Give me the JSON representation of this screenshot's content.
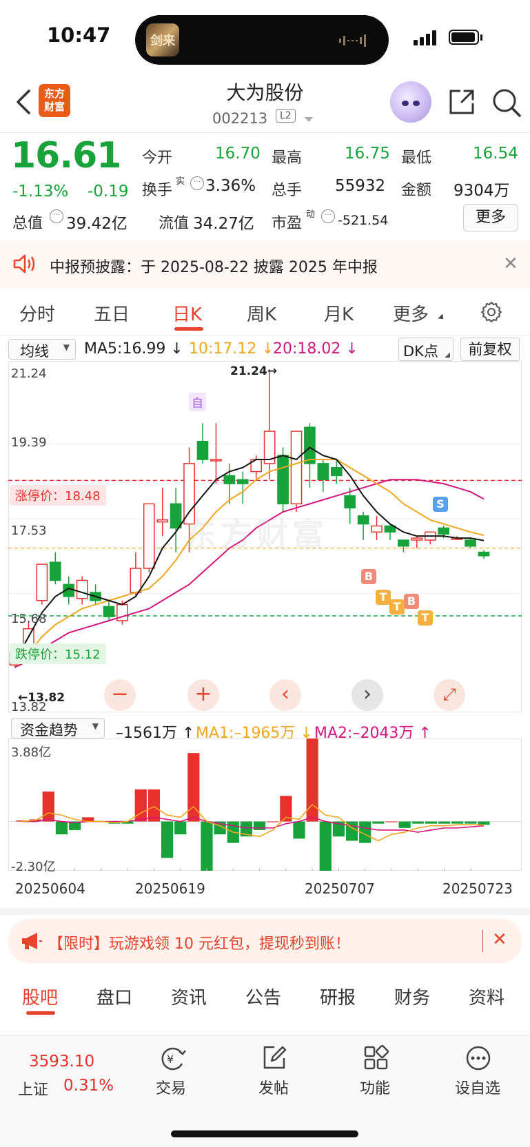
{
  "status_bar": {
    "time": "10:47",
    "island_app_glyph": "剑来"
  },
  "header": {
    "logo_line1": "东方",
    "logo_line2": "财富",
    "stock_name": "大为股份",
    "stock_code": "002213",
    "level_badge": "L2"
  },
  "quote": {
    "price": "16.61",
    "change_pct": "-1.13%",
    "change": "-0.19",
    "open_label": "今开",
    "open": "16.70",
    "high_label": "最高",
    "high": "16.75",
    "low_label": "最低",
    "low": "16.54",
    "turnover_label": "换手",
    "turnover_sup": "实",
    "turnover": "3.36%",
    "volume_label": "总手",
    "volume": "55932",
    "amount_label": "金额",
    "amount": "9304万",
    "mktcap_label": "总值",
    "mktcap": "39.42亿",
    "float_label": "流值",
    "float_cap": "34.27亿",
    "pe_label": "市盈",
    "pe_sup": "动",
    "pe": "-521.54",
    "more_button": "更多"
  },
  "notice": {
    "text": "中报预披露：于 2025-08-22 披露 2025 年中报"
  },
  "period_tabs": [
    "分时",
    "五日",
    "日K",
    "周K",
    "月K",
    "更多"
  ],
  "active_period_tab": "日K",
  "chart_toolbar": {
    "indicator_select": "均线",
    "ma5": "MA5:16.99",
    "ma10": "10:17.12",
    "ma20": "20:18.02",
    "dk_select": "DK点",
    "adjust_button": "前复权"
  },
  "chart_labels": {
    "y_top": "21.24",
    "y_mid1": "19.39",
    "y_mid2": "17.53",
    "y_mid3": "15.68",
    "y_bottom": "13.82",
    "limit_up": "涨停价：18.48",
    "limit_down": "跌停价：15.12",
    "max_marker": "21.24→",
    "min_marker": "←13.82",
    "self_marker": "自",
    "watermark": "东方财富",
    "signal_S": "S",
    "signal_B": "B",
    "signal_T": "T"
  },
  "chart_controls": [
    "−",
    "+",
    "‹",
    "›",
    "⤢"
  ],
  "fund_toolbar": {
    "indicator_select": "资金趋势",
    "value": "–1561万",
    "ma1": "MA1:–1965万",
    "ma2": "MA2:–2043万"
  },
  "fund_labels": {
    "y_top": "3.88亿",
    "y_bottom": "-2.30亿"
  },
  "dates": [
    "20250604",
    "20250619",
    "20250707",
    "20250723"
  ],
  "ad": {
    "text": "【限时】玩游戏领 10 元红包，提现秒到账！"
  },
  "bottom_tabs": [
    "股吧",
    "盘口",
    "资讯",
    "公告",
    "研报",
    "财务",
    "资料"
  ],
  "active_bottom_tab": "股吧",
  "bottom_nav": {
    "index_value": "3593.10",
    "index_name": "上证",
    "index_change": "0.31%",
    "trade": "交易",
    "post": "发帖",
    "function": "功能",
    "watchlist": "设自选"
  },
  "colors": {
    "up": "#e8312c",
    "down": "#18a33a",
    "accent": "#e8442c",
    "ma5": "#111111",
    "ma10": "#f2a51f",
    "ma20": "#d4157e"
  },
  "chart_data": {
    "type": "candlestick",
    "ylim": [
      13.82,
      21.24
    ],
    "candles": [
      {
        "o": 13.9,
        "c": 14.2,
        "h": 14.3,
        "l": 13.82
      },
      {
        "o": 14.2,
        "c": 14.8,
        "h": 15.0,
        "l": 14.1
      },
      {
        "o": 15.5,
        "c": 16.4,
        "h": 16.4,
        "l": 15.4
      },
      {
        "o": 16.45,
        "c": 16.0,
        "h": 16.7,
        "l": 15.9
      },
      {
        "o": 15.9,
        "c": 15.6,
        "h": 16.1,
        "l": 15.4
      },
      {
        "o": 15.55,
        "c": 16.0,
        "h": 16.1,
        "l": 15.4
      },
      {
        "o": 15.7,
        "c": 15.5,
        "h": 15.9,
        "l": 15.4
      },
      {
        "o": 15.35,
        "c": 15.1,
        "h": 15.5,
        "l": 15.0
      },
      {
        "o": 15.0,
        "c": 15.4,
        "h": 15.5,
        "l": 14.9
      },
      {
        "o": 15.7,
        "c": 16.3,
        "h": 16.7,
        "l": 15.6
      },
      {
        "o": 16.3,
        "c": 17.9,
        "h": 17.9,
        "l": 16.2
      },
      {
        "o": 17.45,
        "c": 17.5,
        "h": 18.3,
        "l": 17.1
      },
      {
        "o": 17.9,
        "c": 17.3,
        "h": 18.3,
        "l": 16.7
      },
      {
        "o": 17.4,
        "c": 18.9,
        "h": 19.3,
        "l": 16.7
      },
      {
        "o": 19.45,
        "c": 19.0,
        "h": 19.9,
        "l": 18.9
      },
      {
        "o": 19.0,
        "c": 19.0,
        "h": 19.9,
        "l": 18.4
      },
      {
        "o": 18.6,
        "c": 18.4,
        "h": 18.9,
        "l": 17.9
      },
      {
        "o": 18.5,
        "c": 18.4,
        "h": 18.7,
        "l": 17.9
      },
      {
        "o": 18.7,
        "c": 19.0,
        "h": 19.1,
        "l": 18.5
      },
      {
        "o": 18.9,
        "c": 19.7,
        "h": 21.24,
        "l": 18.5
      },
      {
        "o": 19.1,
        "c": 17.9,
        "h": 19.3,
        "l": 17.7
      },
      {
        "o": 17.9,
        "c": 19.7,
        "h": 19.7,
        "l": 17.7
      },
      {
        "o": 19.8,
        "c": 18.9,
        "h": 19.9,
        "l": 18.3
      },
      {
        "o": 18.9,
        "c": 18.5,
        "h": 19.0,
        "l": 18.2
      },
      {
        "o": 18.8,
        "c": 18.6,
        "h": 19.0,
        "l": 18.4
      },
      {
        "o": 18.1,
        "c": 17.8,
        "h": 18.3,
        "l": 17.4
      },
      {
        "o": 17.6,
        "c": 17.4,
        "h": 17.7,
        "l": 17.0
      },
      {
        "o": 17.2,
        "c": 17.35,
        "h": 17.6,
        "l": 17.0
      },
      {
        "o": 17.35,
        "c": 17.2,
        "h": 17.4,
        "l": 17.0
      },
      {
        "o": 17.0,
        "c": 16.85,
        "h": 17.0,
        "l": 16.7
      },
      {
        "o": 17.0,
        "c": 17.05,
        "h": 17.1,
        "l": 16.8
      },
      {
        "o": 17.0,
        "c": 17.2,
        "h": 17.2,
        "l": 16.9
      },
      {
        "o": 17.3,
        "c": 17.15,
        "h": 17.35,
        "l": 17.05
      },
      {
        "o": 17.05,
        "c": 17.05,
        "h": 17.1,
        "l": 17.0
      },
      {
        "o": 17.0,
        "c": 16.85,
        "h": 17.05,
        "l": 16.8
      },
      {
        "o": 16.7,
        "c": 16.61,
        "h": 16.75,
        "l": 16.54
      }
    ],
    "ma5": [
      14.0,
      14.6,
      15.2,
      15.6,
      15.8,
      15.7,
      15.6,
      15.5,
      15.4,
      15.6,
      16.1,
      16.8,
      17.2,
      17.7,
      18.1,
      18.5,
      18.7,
      18.8,
      19.0,
      19.0,
      19.1,
      19.0,
      19.3,
      19.1,
      19.0,
      18.6,
      18.1,
      17.7,
      17.4,
      17.2,
      17.1,
      17.1,
      17.1,
      17.05,
      17.05,
      16.99
    ],
    "ma10": [
      13.9,
      14.2,
      14.6,
      14.9,
      15.1,
      15.3,
      15.4,
      15.5,
      15.6,
      15.7,
      15.8,
      16.1,
      16.5,
      17.0,
      17.3,
      17.7,
      18.0,
      18.2,
      18.5,
      18.7,
      18.8,
      18.9,
      19.0,
      19.0,
      19.0,
      18.8,
      18.6,
      18.4,
      18.2,
      17.9,
      17.7,
      17.5,
      17.4,
      17.3,
      17.2,
      17.12
    ],
    "ma20": [
      13.85,
      14.0,
      14.3,
      14.5,
      14.7,
      14.8,
      14.9,
      15.0,
      15.1,
      15.2,
      15.3,
      15.5,
      15.7,
      15.9,
      16.2,
      16.5,
      16.8,
      17.0,
      17.3,
      17.5,
      17.7,
      17.8,
      17.9,
      18.0,
      18.1,
      18.2,
      18.3,
      18.4,
      18.5,
      18.5,
      18.5,
      18.45,
      18.4,
      18.3,
      18.2,
      18.02
    ],
    "limit_up": 18.48,
    "limit_down": 15.12,
    "prev_close": 16.8
  },
  "fund_chart_data": {
    "type": "bar",
    "ylim": [
      -2.3,
      3.88
    ],
    "unit": "亿",
    "values": [
      0.05,
      0.1,
      1.4,
      -0.6,
      -0.4,
      0.2,
      0.0,
      -0.1,
      -0.1,
      1.5,
      1.5,
      -1.7,
      -0.6,
      3.2,
      -2.5,
      -0.6,
      -1.0,
      -0.7,
      -0.4,
      0.0,
      1.2,
      -0.8,
      3.88,
      -2.3,
      -0.7,
      -0.9,
      -1.0,
      -0.1,
      0.0,
      -0.3,
      -0.1,
      -0.1,
      -0.1,
      -0.1,
      -0.1,
      -0.15
    ],
    "ma1": [
      0.0,
      0.05,
      0.4,
      0.3,
      0.1,
      0.0,
      0.0,
      -0.05,
      0.0,
      0.4,
      0.7,
      0.3,
      0.2,
      0.7,
      0.0,
      -0.2,
      -0.5,
      -0.6,
      -0.7,
      -0.4,
      0.2,
      0.1,
      0.8,
      0.3,
      0.2,
      -0.3,
      -0.6,
      -0.9,
      -0.6,
      -0.5,
      -0.3,
      -0.2,
      -0.2,
      -0.15,
      -0.15,
      -0.16
    ],
    "ma2": [
      0.0,
      0.0,
      0.1,
      0.0,
      -0.05,
      0.0,
      0.0,
      0.0,
      0.0,
      0.1,
      0.2,
      0.1,
      0.0,
      0.2,
      0.0,
      -0.1,
      -0.2,
      -0.3,
      -0.3,
      -0.3,
      -0.1,
      0.0,
      0.2,
      0.0,
      -0.1,
      -0.2,
      -0.3,
      -0.4,
      -0.4,
      -0.4,
      -0.5,
      -0.4,
      -0.3,
      -0.3,
      -0.25,
      -0.2
    ]
  }
}
